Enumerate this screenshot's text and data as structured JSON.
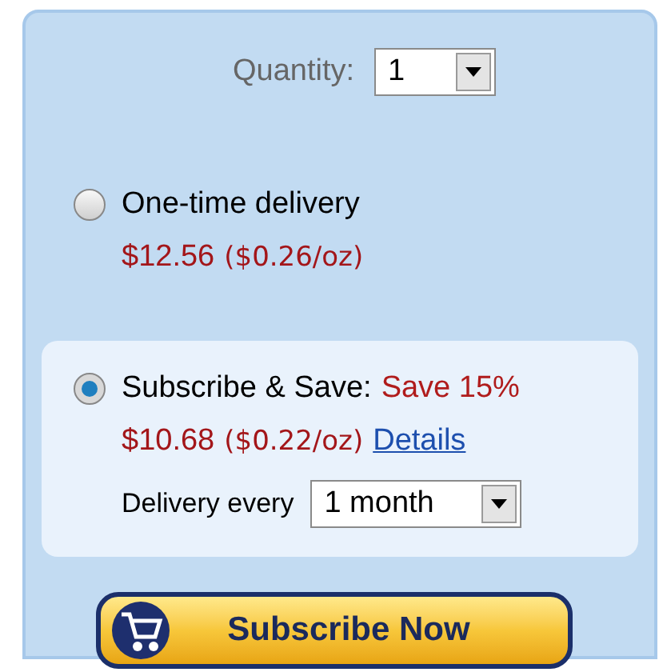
{
  "quantity": {
    "label": "Quantity:",
    "value": "1"
  },
  "options": [
    {
      "label": "One-time delivery",
      "selected": false,
      "price": "$12.56",
      "unit_price": "($0.26/oz)"
    },
    {
      "label": "Subscribe & Save:",
      "selected": true,
      "savings": "Save 15%",
      "price": "$10.68",
      "unit_price": "($0.22/oz)",
      "link": "Details",
      "delivery": {
        "label": "Delivery every",
        "value": "1 month"
      }
    }
  ],
  "button": {
    "label": "Subscribe Now"
  }
}
